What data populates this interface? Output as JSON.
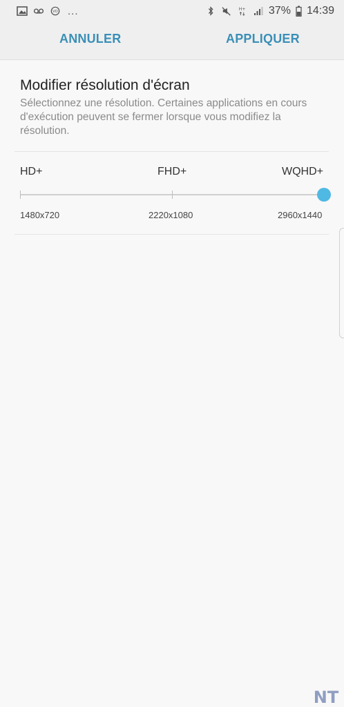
{
  "status_bar": {
    "icons_left": [
      "image-icon",
      "voicemail-icon",
      "vo-icon"
    ],
    "overflow": "...",
    "icons_right": [
      "bluetooth-icon",
      "mute-icon",
      "network-hplus-icon",
      "signal-icon"
    ],
    "battery_percent": "37%",
    "time": "14:39"
  },
  "action_bar": {
    "cancel_label": "ANNULER",
    "apply_label": "APPLIQUER",
    "accent_color": "#3a8fb7"
  },
  "screen_resolution": {
    "title": "Modifier résolution d'écran",
    "description": "Sélectionnez une résolution. Certaines applications en cours d'exécution peuvent se fermer lorsque vous modifiez la résolution.",
    "options": [
      {
        "label": "HD+",
        "value": "1480x720"
      },
      {
        "label": "FHD+",
        "value": "2220x1080"
      },
      {
        "label": "WQHD+",
        "value": "2960x1440"
      }
    ],
    "selected_index": 2,
    "thumb_color": "#4fb9e3"
  },
  "watermark": {
    "text": "NT"
  }
}
